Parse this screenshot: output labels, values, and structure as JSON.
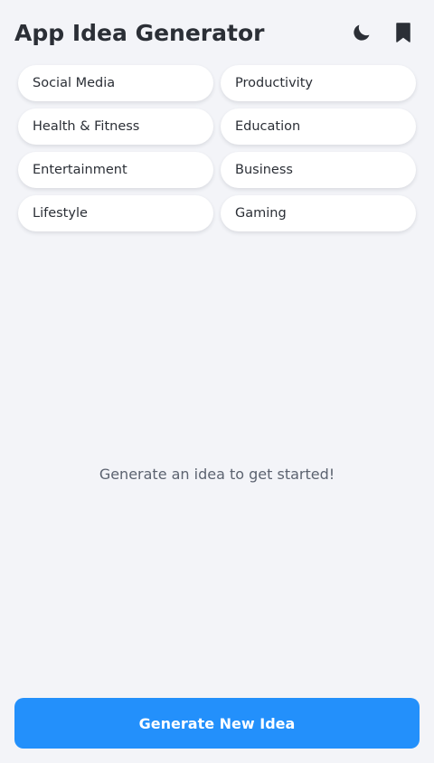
{
  "header": {
    "title": "App Idea Generator",
    "icons": [
      "moon-icon",
      "bookmark-icon"
    ]
  },
  "categories": [
    "Social Media",
    "Productivity",
    "Health & Fitness",
    "Education",
    "Entertainment",
    "Business",
    "Lifestyle",
    "Gaming"
  ],
  "empty_state": {
    "message": "Generate an idea to get started!"
  },
  "actions": {
    "generate_label": "Generate New Idea"
  },
  "colors": {
    "background": "#f3f4f8",
    "accent": "#2390fb",
    "text": "#2b2f36",
    "muted_text": "#5c6370"
  }
}
